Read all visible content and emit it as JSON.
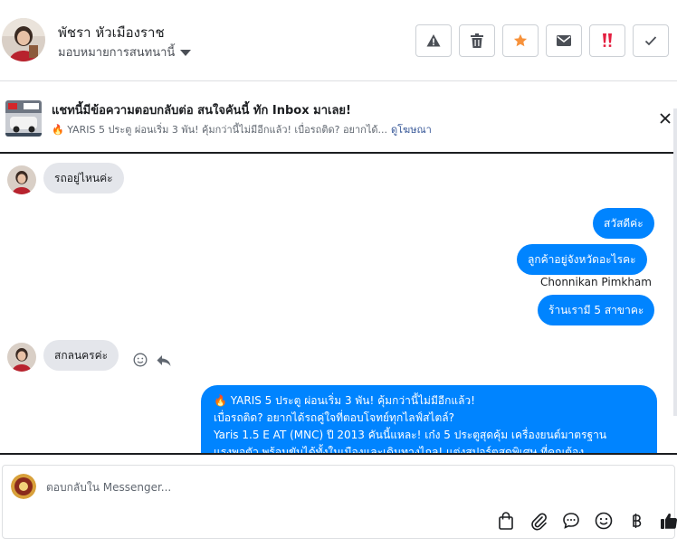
{
  "header": {
    "contact_name": "พัชรา หัวเมืองราช",
    "assign_label": "มอบหมายการสนทนานี้",
    "actions": {
      "spam": "spam-icon",
      "delete": "trash-icon",
      "star": "star-icon",
      "mark_unread": "envelope-icon",
      "follow_up": "double-exclamation-icon",
      "done": "check-icon"
    },
    "colors": {
      "star": "#f7923b",
      "follow_up": "#e41e3f"
    }
  },
  "ad_banner": {
    "title": "แชทนี้มีข้อความตอบกลับต่อ สนใจคันนี้ ทัก Inbox มาเลย!",
    "subtitle": "🔥 YARIS 5 ประตู ผ่อนเริ่ม 3 พัน! คุ้มกว่านี้ไม่มีอีกแล้ว! เบื่อรถติด? อยากได้...",
    "link_label": "ดูโฆษณา"
  },
  "messages": {
    "m1": "รถอยู่ไหนค่ะ",
    "m2": "สวัสดีค่ะ",
    "m3": "ลูกค้าอยู่จังหวัดอะไรคะ",
    "sender_name": "Chonnikan Pimkham",
    "m4": "ร้านเรามี 5 สาขาคะ",
    "m5": "สกลนครค่ะ",
    "m6_lines": [
      "🔥 YARIS 5 ประตู ผ่อนเริ่ม 3 พัน! คุ้มกว่านี้ไม่มีอีกแล้ว!",
      "เบื่อรถติด? อยากได้รถคู่ใจที่ตอบโจทย์ทุกไลฟ์สไตล์?",
      "Yaris 1.5 E AT (MNC) ปี 2013 คันนี้แหละ! เก๋ง 5 ประตูสุดคุ้ม เครื่องยนต์มาตรฐาน",
      "แรงพอตัว พร้อมขับได้ทั้งในเมืองและเดินทางไกล! แต่งสปอร์ตสุดพิเศษ ที่คุณต้อง"
    ],
    "colors": {
      "outgoing": "#0084ff",
      "incoming": "#e4e6eb"
    }
  },
  "composer": {
    "placeholder": "ตอบกลับใน Messenger...",
    "tools": [
      "shopping-bag-icon",
      "paperclip-icon",
      "chat-bubble-icon",
      "emoji-icon",
      "baht-icon",
      "thumbs-up-icon"
    ]
  }
}
